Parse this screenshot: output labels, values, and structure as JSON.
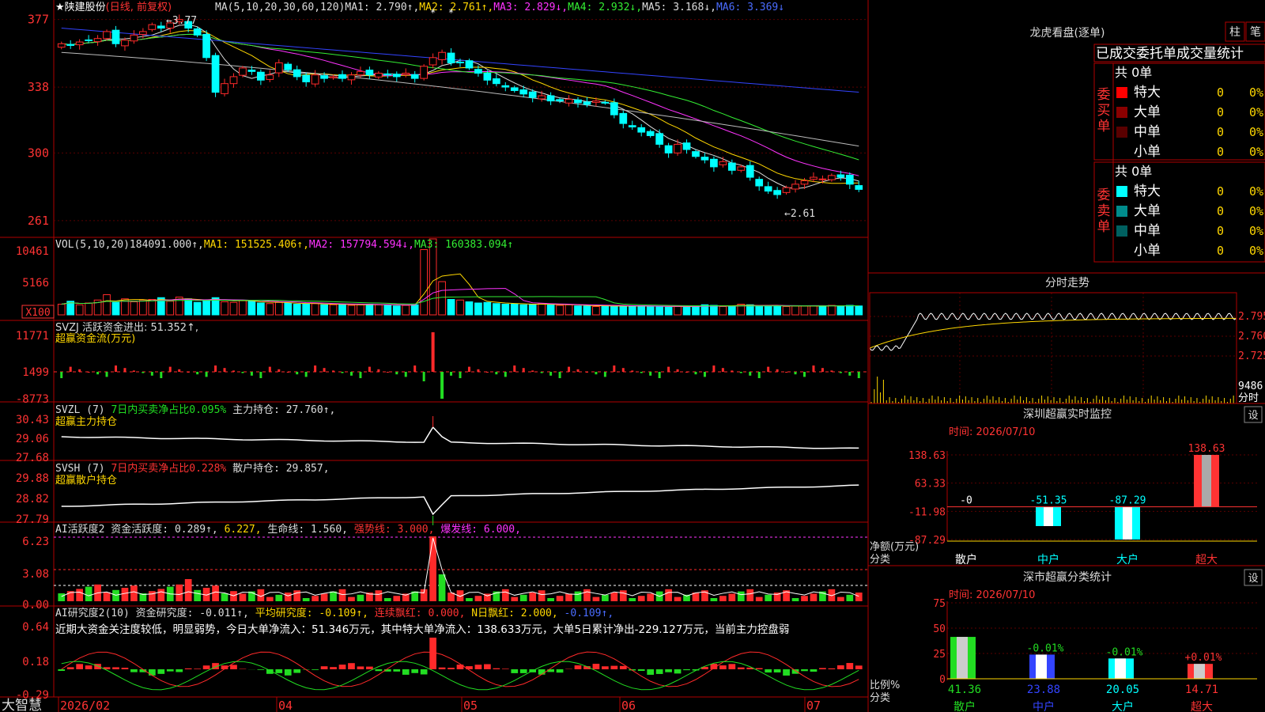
{
  "stock": {
    "star": "★",
    "name": "陕建股份",
    "mode": "(日线, 前复权)"
  },
  "ma_line": [
    {
      "t": "MA(5,10,20,30,60,120)",
      "c": "#dddddd"
    },
    {
      "t": "MA1: 2.790↑,",
      "c": "#dddddd"
    },
    {
      "t": "MA2: 2.761↑,",
      "c": "#ffd700"
    },
    {
      "t": "MA3: 2.829↓,",
      "c": "#ff33ff"
    },
    {
      "t": "MA4: 2.932↓,",
      "c": "#33ee33"
    },
    {
      "t": "MA5: 3.168↓,",
      "c": "#dddddd"
    },
    {
      "t": "MA6: 3.369↓",
      "c": "#4a6cff"
    }
  ],
  "price_axis": [
    "377",
    "338",
    "300",
    "261"
  ],
  "price_marks": {
    "high": "←3.77",
    "low": "←2.61",
    "flag_top": "*",
    "flag_top2": "*"
  },
  "vol_line": [
    {
      "t": "VOL(5,10,20)",
      "c": "#dddddd"
    },
    {
      "t": "184091.000↑,",
      "c": "#dddddd"
    },
    {
      "t": "MA1: 151525.406↑,",
      "c": "#ffd700"
    },
    {
      "t": "MA2: 157794.594↓,",
      "c": "#ff33ff"
    },
    {
      "t": "MA3: 160383.094↑",
      "c": "#33ee33"
    }
  ],
  "vol_axis": [
    "10461",
    "5166"
  ],
  "vol_unit": "X100",
  "svzj": {
    "line1": "SVZJ  活跃资金进出: 51.352↑,",
    "line2": "超赢资金流(万元)",
    "axis": [
      "11771",
      "1499",
      "-8773"
    ]
  },
  "svzl": {
    "p1": "SVZL (7) ",
    "p2": "7日内买卖净占比0.095%",
    "p3": " 主力持仓: 27.760↑,",
    "line2": "超赢主力持仓",
    "axis": [
      "30.43",
      "29.06",
      "27.68"
    ]
  },
  "svsh": {
    "p1": "SVSH (7) ",
    "p2": "7日内买卖净占比0.228%",
    "p3": " 散户持仓: 29.857,",
    "line2": "超赢散户持仓",
    "axis": [
      "29.88",
      "28.82",
      "27.79"
    ]
  },
  "ai1": {
    "parts": [
      {
        "t": "AI活跃度2 资金活跃度: 0.289↑,",
        "c": "#dddddd"
      },
      {
        "t": " 6.227,",
        "c": "#ffd700"
      },
      {
        "t": " 生命线: 1.560,",
        "c": "#dddddd"
      },
      {
        "t": " 强势线: 3.000,",
        "c": "#ff3333"
      },
      {
        "t": " 爆发线: 6.000,",
        "c": "#ff33ff"
      }
    ],
    "axis": [
      "6.23",
      "3.08",
      "0.00"
    ]
  },
  "ai2": {
    "parts": [
      {
        "t": "AI研究度2(10) 资金研究度: -0.011↑,",
        "c": "#dddddd"
      },
      {
        "t": " 平均研究度: -0.109↑,",
        "c": "#ffd700"
      },
      {
        "t": " 连续飘红: 0.000,",
        "c": "#ff3333"
      },
      {
        "t": " N日飘红: 2.000,",
        "c": "#ffd700"
      },
      {
        "t": " -0.109↑,",
        "c": "#4a6cff"
      }
    ],
    "comment": "近期大资金关注度较低，明显弱势，今日大单净流入：51.346万元，其中特大单净流入：138.633万元，大单5日累计净出-229.127万元，当前主力控盘弱",
    "axis": [
      "0.64",
      "0.18",
      "-0.29"
    ]
  },
  "xaxis": [
    "2026/02",
    "04",
    "05",
    "06",
    "07"
  ],
  "brand": "大智慧",
  "lhb": {
    "title": "龙虎看盘(逐单)",
    "btn1": "柱",
    "btn2": "笔",
    "header": "已成交委托单成交量统计",
    "buy_label": "委买单",
    "sell_label": "委卖单",
    "buy_total": "共 0单",
    "sell_total": "共 0单",
    "rows": [
      {
        "label": "特大",
        "v": "0",
        "p": "0%"
      },
      {
        "label": "大单",
        "v": "0",
        "p": "0%"
      },
      {
        "label": "中单",
        "v": "0",
        "p": "0%"
      },
      {
        "label": "小单",
        "v": "0",
        "p": "0%"
      }
    ],
    "buy_colors": [
      "#ff0000",
      "#8b0000",
      "#5a0000",
      "#000000"
    ],
    "sell_colors": [
      "#00ffff",
      "#008b8b",
      "#006060",
      "#000000"
    ]
  },
  "fenshi": {
    "title": "分时走势",
    "price_ticks": [
      "2.795",
      "2.760",
      "2.725"
    ],
    "vol_tick": "9486",
    "vol_unit": "分时"
  },
  "monitor": {
    "title": "深圳超赢实时监控",
    "set": "设",
    "time": "时间: 2026/07/10",
    "axis": [
      "138.63",
      "63.33",
      "-11.98",
      "-87.29"
    ],
    "ylabel": "净额(万元)",
    "xlabel": "分类",
    "categories": [
      "散户",
      "中户",
      "大户",
      "超大"
    ],
    "value_labels": [
      "-0",
      "-51.35",
      "-87.29",
      "138.63"
    ]
  },
  "stats": {
    "title": "深市超赢分类统计",
    "set": "设",
    "time": "时间: 2026/07/10",
    "axis": [
      "75",
      "50",
      "25",
      "0"
    ],
    "ylabel": "比例%",
    "xlabel": "分类",
    "categories": [
      "散户",
      "中户",
      "大户",
      "超大"
    ],
    "top_labels": [
      "",
      "-0.01%",
      "-0.01%",
      "+0.01%"
    ],
    "bottom_labels": [
      "41.36",
      "23.88",
      "20.05",
      "14.71"
    ]
  },
  "chart_data": [
    {
      "type": "candlestick",
      "title": "陕建股份 (日线, 前复权)",
      "ylim": [
        2.55,
        3.8
      ],
      "x": [
        "2026/02",
        "04",
        "05",
        "06",
        "07"
      ],
      "close": [
        3.63,
        3.62,
        3.64,
        3.65,
        3.66,
        3.7,
        3.63,
        3.65,
        3.68,
        3.7,
        3.74,
        3.72,
        3.75,
        3.77,
        3.72,
        3.68,
        3.55,
        3.35,
        3.4,
        3.44,
        3.49,
        3.47,
        3.42,
        3.45,
        3.52,
        3.48,
        3.44,
        3.41,
        3.45,
        3.43,
        3.44,
        3.43,
        3.45,
        3.47,
        3.45,
        3.46,
        3.45,
        3.44,
        3.46,
        3.43,
        3.5,
        3.55,
        3.58,
        3.52,
        3.52,
        3.49,
        3.46,
        3.42,
        3.4,
        3.38,
        3.36,
        3.34,
        3.32,
        3.33,
        3.3,
        3.3,
        3.31,
        3.29,
        3.28,
        3.3,
        3.29,
        3.22,
        3.17,
        3.15,
        3.12,
        3.1,
        3.05,
        3.0,
        3.05,
        3.02,
        2.98,
        2.96,
        2.92,
        2.95,
        2.9,
        2.92,
        2.86,
        2.81,
        2.78,
        2.76,
        2.8,
        2.82,
        2.84,
        2.86,
        2.85,
        2.87,
        2.86,
        2.82,
        2.79
      ],
      "series": [
        {
          "name": "MA1",
          "last": 2.79
        },
        {
          "name": "MA2",
          "last": 2.761
        },
        {
          "name": "MA3",
          "last": 2.829
        },
        {
          "name": "MA4",
          "last": 2.932
        },
        {
          "name": "MA5",
          "last": 3.168
        },
        {
          "name": "MA6",
          "last": 3.369
        }
      ],
      "high_mark": 3.77,
      "low_mark": 2.61
    },
    {
      "type": "bar",
      "title": "VOL(5,10,20)",
      "ylim": [
        0,
        12000
      ],
      "unit": "X100",
      "values": [
        1800,
        2300,
        1700,
        2000,
        2500,
        3400,
        2100,
        2700,
        2200,
        2500,
        2600,
        2900,
        2300,
        3000,
        2700,
        2100,
        2500,
        2900,
        2200,
        2100,
        2400,
        2300,
        2000,
        1900,
        2100,
        2000,
        1800,
        1800,
        1900,
        1700,
        1700,
        1800,
        1600,
        1700,
        1800,
        1700,
        1700,
        1500,
        1600,
        1700,
        11000,
        12800,
        5600,
        2600,
        2500,
        2200,
        2000,
        2100,
        1900,
        1800,
        1800,
        1700,
        1800,
        1900,
        1700,
        1600,
        1700,
        1500,
        1500,
        1400,
        1600,
        1400,
        1500,
        1500,
        1500,
        1400,
        1400,
        1300,
        1500,
        1400,
        1500,
        1700,
        1600,
        1400,
        1500,
        1800,
        1700,
        1500,
        1500,
        1600,
        1400,
        1500,
        1500,
        1500,
        1500,
        1600,
        1500,
        1600,
        1500
      ],
      "last": 184091.0
    },
    {
      "type": "bar",
      "title": "SVZJ 超赢资金流(万元)",
      "ylim": [
        -8773,
        11771
      ],
      "last": 51.352
    },
    {
      "type": "line",
      "title": "SVZL 超赢主力持仓",
      "ylim": [
        27.68,
        30.43
      ],
      "last": 27.76
    },
    {
      "type": "line",
      "title": "SVSH 超赢散户持仓",
      "ylim": [
        27.79,
        29.88
      ],
      "last": 29.857
    },
    {
      "type": "bar",
      "title": "AI活跃度2",
      "ylim": [
        0,
        6.23
      ],
      "last": 0.289
    },
    {
      "type": "bar",
      "title": "AI研究度2(10)",
      "ylim": [
        -0.29,
        0.64
      ],
      "last": -0.011
    },
    {
      "type": "bar",
      "title": "深圳超赢实时监控",
      "categories": [
        "散户",
        "中户",
        "大户",
        "超大"
      ],
      "values": [
        -0.0,
        -51.35,
        -87.29,
        138.63
      ],
      "ylim": [
        -87.29,
        138.63
      ],
      "ylabel": "净额(万元)"
    },
    {
      "type": "bar",
      "title": "深市超赢分类统计",
      "categories": [
        "散户",
        "中户",
        "大户",
        "超大"
      ],
      "values": [
        41.36,
        23.88,
        20.05,
        14.71
      ],
      "ylim": [
        0,
        75
      ],
      "ylabel": "比例%"
    }
  ]
}
